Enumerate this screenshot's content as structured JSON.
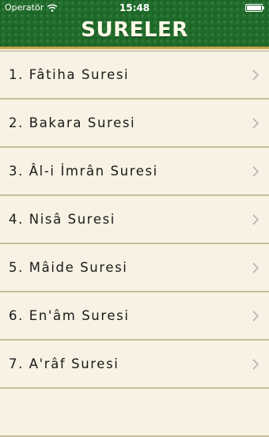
{
  "status_bar": {
    "carrier": "Operatör",
    "time": "15:48"
  },
  "header": {
    "title": "SURELER"
  },
  "surahs": [
    {
      "label": "1. Fâtiha Suresi"
    },
    {
      "label": "2. Bakara Suresi"
    },
    {
      "label": "3. Âl-i İmrân Suresi"
    },
    {
      "label": "4. Nisâ Suresi"
    },
    {
      "label": "5. Mâide Suresi"
    },
    {
      "label": "6. En'âm Suresi"
    },
    {
      "label": "7. A'râf Suresi"
    },
    {
      "label": ""
    }
  ],
  "colors": {
    "header_green": "#1f6b2a",
    "list_background": "#f6f1e1",
    "divider": "#c9bc9c",
    "chevron": "#b5b5b5"
  },
  "icons": {
    "row_accessory": "chevron-right-icon",
    "wifi": "wifi-icon",
    "battery": "battery-icon"
  }
}
